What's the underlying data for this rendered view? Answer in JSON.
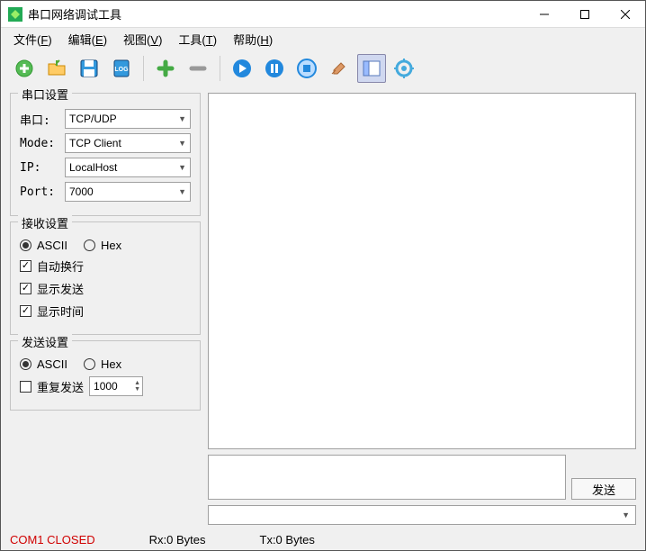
{
  "window": {
    "title": "串口网络调试工具"
  },
  "menu": {
    "file": "文件",
    "file_k": "F",
    "edit": "编辑",
    "edit_k": "E",
    "view": "视图",
    "view_k": "V",
    "tools": "工具",
    "tools_k": "T",
    "help": "帮助",
    "help_k": "H"
  },
  "serial": {
    "legend": "串口设置",
    "port_label": "串口:",
    "port_value": "TCP/UDP",
    "mode_label": "Mode:",
    "mode_value": "TCP Client",
    "ip_label": "IP:",
    "ip_value": "LocalHost",
    "portnum_label": "Port:",
    "portnum_value": "7000"
  },
  "recv": {
    "legend": "接收设置",
    "ascii": "ASCII",
    "hex": "Hex",
    "wrap": "自动换行",
    "show_send": "显示发送",
    "show_time": "显示时间"
  },
  "send": {
    "legend": "发送设置",
    "ascii": "ASCII",
    "hex": "Hex",
    "repeat": "重复发送",
    "interval": "1000",
    "send_btn": "发送"
  },
  "status": {
    "port": "COM1 CLOSED",
    "rx": "Rx:0 Bytes",
    "tx": "Tx:0 Bytes"
  }
}
